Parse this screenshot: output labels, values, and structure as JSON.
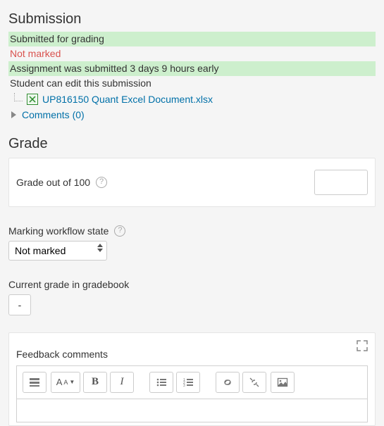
{
  "submission": {
    "heading": "Submission",
    "status_submitted": "Submitted for grading",
    "status_marking": "Not marked",
    "status_timing": "Assignment was submitted 3 days 9 hours early",
    "status_editable": "Student can edit this submission",
    "file_name": "UP816150 Quant Excel Document.xlsx",
    "comments_label": "Comments (0)"
  },
  "grade": {
    "heading": "Grade",
    "out_of_label": "Grade out of 100",
    "grade_value": "",
    "workflow_label": "Marking workflow state",
    "workflow_value": "Not marked",
    "current_label": "Current grade in gradebook",
    "current_value": "-"
  },
  "feedback": {
    "heading": "Feedback comments"
  }
}
